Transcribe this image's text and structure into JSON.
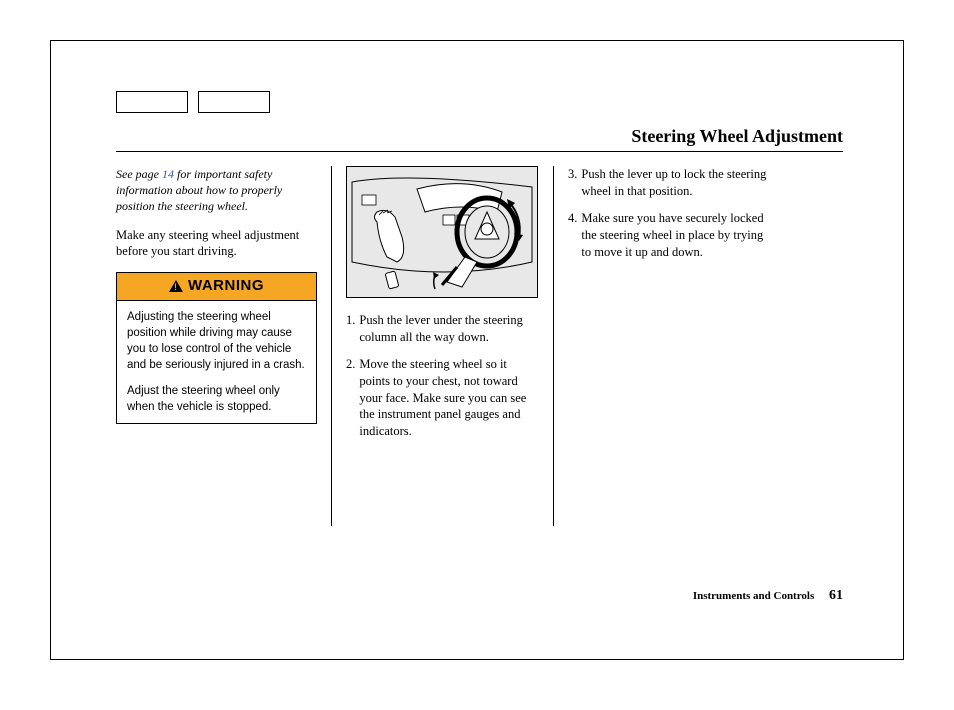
{
  "title": "Steering Wheel Adjustment",
  "intro": {
    "prefix": "See page ",
    "page_ref": "14",
    "suffix": " for important safety information about how to properly position the steering wheel."
  },
  "lead_paragraph": "Make any steering wheel adjustment before you start driving.",
  "warning": {
    "label": "WARNING",
    "p1": "Adjusting the steering wheel position while driving may cause you to lose control of the vehicle and be seriously injured in a crash.",
    "p2": "Adjust the steering wheel only when the vehicle is stopped."
  },
  "steps": {
    "s1_num": "1.",
    "s1": "Push the lever under the steering column all the way down.",
    "s2_num": "2.",
    "s2": "Move the steering wheel so it points to your chest, not toward your face. Make sure you can see the instrument panel gauges and indicators.",
    "s3_num": "3.",
    "s3": "Push the lever up to lock the steering wheel in that position.",
    "s4_num": "4.",
    "s4": "Make sure you have securely locked the steering wheel in place by trying to move it up and down."
  },
  "footer": {
    "section": "Instruments and Controls",
    "page": "61"
  }
}
